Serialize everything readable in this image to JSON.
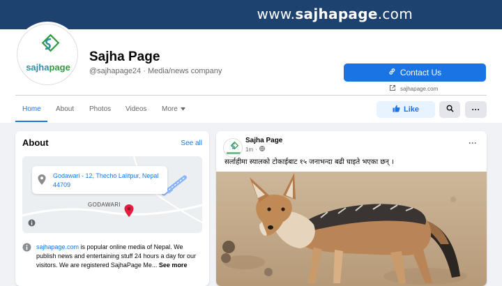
{
  "cover": {
    "url_prefix": "www.",
    "url_brand": "sajhapage",
    "url_suffix": ".com",
    "color": "#1d4270"
  },
  "profile": {
    "name": "Sajha Page",
    "handle": "@sajhapage24 · Media/news company",
    "logo_text_1": "sajha",
    "logo_text_2": "page",
    "logo_colors": {
      "sajha": "#2f8fa6",
      "page": "#2e9b3f"
    }
  },
  "actions": {
    "contact_label": "Contact Us",
    "website": "sajhapage.com",
    "like_label": "Like",
    "more_label": "···",
    "accent": "#1b74e4"
  },
  "tabs": [
    "Home",
    "About",
    "Photos",
    "Videos",
    "More"
  ],
  "about": {
    "title": "About",
    "see_all": "See all",
    "address": "Godawari - 12, Thecho Lalitpur, Nepal 44709",
    "map_label": "GODAWARI",
    "desc_link": "sajhapage.com",
    "desc_rest": " is popular online media of Nepal. We publish news and entertaining stuff 24 hours a day for our visitors. We are registered SajhaPage Me... ",
    "see_more": "See more"
  },
  "post": {
    "author": "Sajha Page",
    "time": "1m",
    "text": "सर्लाहीमा स्यालको टोकाईबाट १५ जनाभन्दा बढी घाइते भएका छन् ।",
    "menu": "···",
    "image_subject": "jackal photo"
  }
}
